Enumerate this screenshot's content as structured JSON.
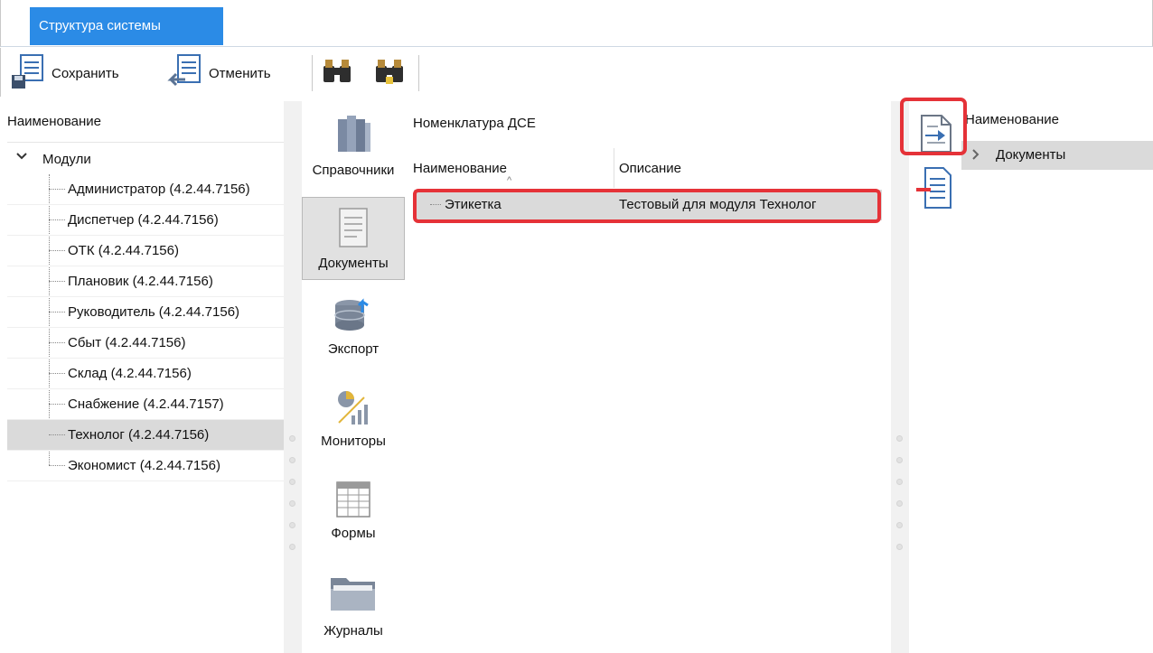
{
  "tabs": [
    {
      "label": "Структура системы",
      "active": true
    }
  ],
  "toolbar": {
    "save_label": "Сохранить",
    "cancel_label": "Отменить"
  },
  "tree": {
    "header": "Наименование",
    "root": "Модули",
    "items": [
      {
        "label": "Администратор (4.2.44.7156)",
        "selected": false
      },
      {
        "label": "Диспетчер (4.2.44.7156)",
        "selected": false
      },
      {
        "label": "ОТК (4.2.44.7156)",
        "selected": false
      },
      {
        "label": "Плановик (4.2.44.7156)",
        "selected": false
      },
      {
        "label": "Руководитель (4.2.44.7156)",
        "selected": false
      },
      {
        "label": "Сбыт (4.2.44.7156)",
        "selected": false
      },
      {
        "label": "Склад (4.2.44.7156)",
        "selected": false
      },
      {
        "label": "Снабжение (4.2.44.7157)",
        "selected": false
      },
      {
        "label": "Технолог (4.2.44.7156)",
        "selected": true
      },
      {
        "label": "Экономист (4.2.44.7156)",
        "selected": false
      }
    ]
  },
  "categories": [
    {
      "label": "Справочники",
      "selected": false
    },
    {
      "label": "Документы",
      "selected": true
    },
    {
      "label": "Экспорт",
      "selected": false
    },
    {
      "label": "Мониторы",
      "selected": false
    },
    {
      "label": "Формы",
      "selected": false
    },
    {
      "label": "Журналы",
      "selected": false
    }
  ],
  "grid": {
    "title": "Номенклатура ДСЕ",
    "columns": [
      "Наименование",
      "Описание"
    ],
    "rows": [
      {
        "name": "Этикетка",
        "description": "Тестовый для модуля Технолог"
      }
    ]
  },
  "right_panel": {
    "header": "Наименование",
    "rows": [
      {
        "label": "Документы"
      }
    ]
  },
  "colors": {
    "accent": "#2b8be6",
    "highlight": "#e53238",
    "selection": "#dadada"
  },
  "icons": [
    "save-icon",
    "cancel-icon",
    "binoculars-icon",
    "binoculars-next-icon",
    "books-icon",
    "document-icon",
    "database-export-icon",
    "monitor-chart-icon",
    "form-table-icon",
    "folder-icon",
    "add-document-icon",
    "remove-document-icon"
  ]
}
